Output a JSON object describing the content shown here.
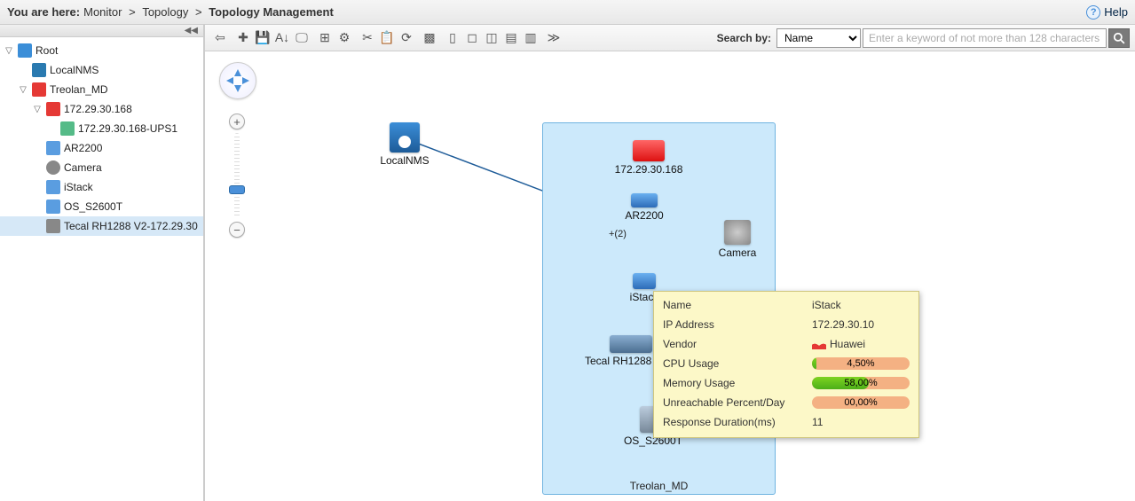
{
  "breadcrumb": {
    "prefix": "You are here:",
    "path": [
      "Monitor",
      "Topology",
      "Topology Management"
    ]
  },
  "help_label": "Help",
  "tree": {
    "items": [
      {
        "indent": 0,
        "toggle": "▽",
        "icon": "ic-network",
        "label": "Root",
        "selected": false
      },
      {
        "indent": 1,
        "toggle": "",
        "icon": "ic-nms",
        "label": "LocalNMS",
        "selected": false
      },
      {
        "indent": 1,
        "toggle": "▽",
        "icon": "ic-red",
        "label": "Treolan_MD",
        "selected": false
      },
      {
        "indent": 2,
        "toggle": "▽",
        "icon": "ic-red",
        "label": "172.29.30.168",
        "selected": false
      },
      {
        "indent": 3,
        "toggle": "",
        "icon": "ic-ups",
        "label": "172.29.30.168-UPS1",
        "selected": false
      },
      {
        "indent": 2,
        "toggle": "",
        "icon": "ic-router",
        "label": "AR2200",
        "selected": false
      },
      {
        "indent": 2,
        "toggle": "",
        "icon": "ic-cam",
        "label": "Camera",
        "selected": false
      },
      {
        "indent": 2,
        "toggle": "",
        "icon": "ic-stack",
        "label": "iStack",
        "selected": false
      },
      {
        "indent": 2,
        "toggle": "",
        "icon": "ic-storage",
        "label": "OS_S2600T",
        "selected": false
      },
      {
        "indent": 2,
        "toggle": "",
        "icon": "ic-server",
        "label": "Tecal RH1288 V2-172.29.30",
        "selected": true
      }
    ]
  },
  "toolbar": {
    "buttons": [
      "⇦",
      "✚",
      "💾",
      "A↓",
      "🖵",
      "⊞",
      "⚙",
      "✂",
      "📋",
      "⟳",
      "▩",
      "▯",
      "◻",
      "◫",
      "▤",
      "▥",
      "≫"
    ],
    "search_label": "Search by:",
    "search_field": "Name",
    "search_placeholder": "Enter a keyword of not more than 128 characters."
  },
  "topology": {
    "group_label": "Treolan_MD",
    "link_annotation": "+(2)",
    "nodes": {
      "localnms": {
        "label": "LocalNMS"
      },
      "gateway": {
        "label": "172.29.30.168"
      },
      "ar2200": {
        "label": "AR2200"
      },
      "camera": {
        "label": "Camera"
      },
      "istack": {
        "label": "iStack"
      },
      "tecal": {
        "label": "Tecal RH1288 V2-1"
      },
      "os2600": {
        "label": "OS_S2600T"
      }
    }
  },
  "tooltip": {
    "rows": {
      "name": {
        "k": "Name",
        "v": "iStack"
      },
      "ip": {
        "k": "IP Address",
        "v": "172.29.30.10"
      },
      "vendor": {
        "k": "Vendor",
        "v": "Huawei"
      },
      "cpu": {
        "k": "CPU Usage",
        "v": "4,50%",
        "pct": 4.5
      },
      "mem": {
        "k": "Memory Usage",
        "v": "58,00%",
        "pct": 58.0
      },
      "unreach": {
        "k": "Unreachable Percent/Day",
        "v": "00,00%",
        "pct": 0.0
      },
      "resp": {
        "k": "Response Duration(ms)",
        "v": "11"
      }
    }
  }
}
